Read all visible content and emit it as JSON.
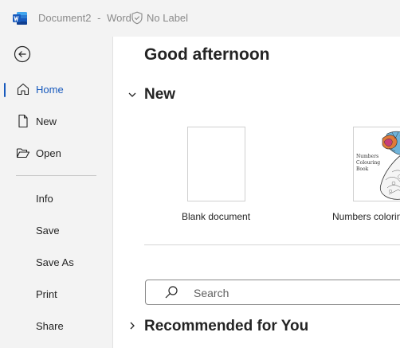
{
  "titlebar": {
    "app_icon": "word-logo",
    "document_name": "Document2",
    "separator": "-",
    "app_name": "Word",
    "label_icon": "shield-check-icon",
    "sensitivity_label": "No Label"
  },
  "sidebar": {
    "back_icon": "back-arrow-icon",
    "primary": [
      {
        "label": "Home",
        "icon": "home-icon",
        "active": true
      },
      {
        "label": "New",
        "icon": "new-document-icon",
        "active": false
      },
      {
        "label": "Open",
        "icon": "folder-open-icon",
        "active": false
      }
    ],
    "secondary": [
      {
        "label": "Info"
      },
      {
        "label": "Save"
      },
      {
        "label": "Save As"
      },
      {
        "label": "Print"
      },
      {
        "label": "Share"
      }
    ]
  },
  "main": {
    "greeting": "Good afternoon",
    "new_section": {
      "title": "New",
      "toggle_icon": "chevron-down-icon",
      "templates": [
        {
          "label": "Blank document",
          "thumb": "blank"
        },
        {
          "label": "Numbers coloring",
          "thumb": "numbers-coloring-book",
          "thumb_text": [
            "Numbers",
            "Colouring",
            "Book"
          ]
        }
      ]
    },
    "search": {
      "placeholder": "Search",
      "icon": "search-icon"
    },
    "recommended_section": {
      "title": "Recommended for You",
      "toggle_icon": "chevron-right-icon"
    }
  },
  "colors": {
    "accent": "#185abd",
    "word_blue": "#2b579a",
    "background": "#f3f3f3"
  }
}
